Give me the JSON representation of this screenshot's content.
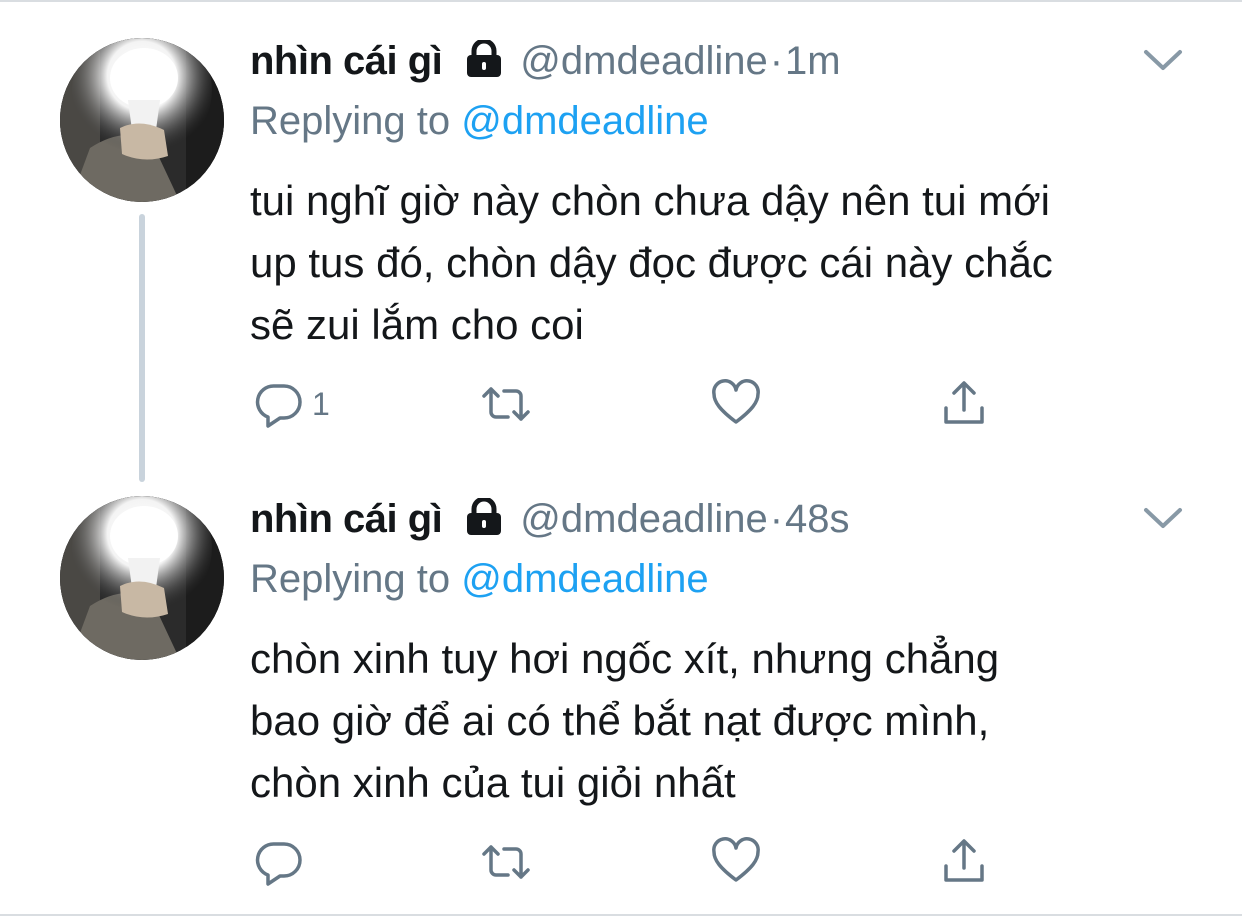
{
  "colors": {
    "text": "#14171a",
    "secondary": "#657786",
    "link": "#1da1f2",
    "thread_line": "#c9d3dc"
  },
  "tweets": [
    {
      "display_name": "nhìn cái gì",
      "handle": "@dmdeadline",
      "separator": "·",
      "time": "1m",
      "replying_prefix": "Replying to ",
      "replying_to": "@dmdeadline",
      "body_lines": [
        "tui nghĩ giờ này chòn chưa dậy nên tui mới",
        "up tus đó, chòn dậy đọc được cái này chắc",
        "sẽ zui lắm cho coi"
      ],
      "reply_count": "1",
      "icons": [
        "lock-icon",
        "chevron-down-icon",
        "reply-icon",
        "retweet-icon",
        "like-icon",
        "share-icon"
      ]
    },
    {
      "display_name": "nhìn cái gì",
      "handle": "@dmdeadline",
      "separator": "·",
      "time": "48s",
      "replying_prefix": "Replying to ",
      "replying_to": "@dmdeadline",
      "body_lines": [
        "chòn xinh tuy hơi ngốc xít, nhưng chẳng",
        "bao giờ để ai có thể bắt nạt được mình,",
        "chòn xinh của tui giỏi nhất"
      ],
      "reply_count": "",
      "icons": [
        "lock-icon",
        "chevron-down-icon",
        "reply-icon",
        "retweet-icon",
        "like-icon",
        "share-icon"
      ]
    }
  ]
}
